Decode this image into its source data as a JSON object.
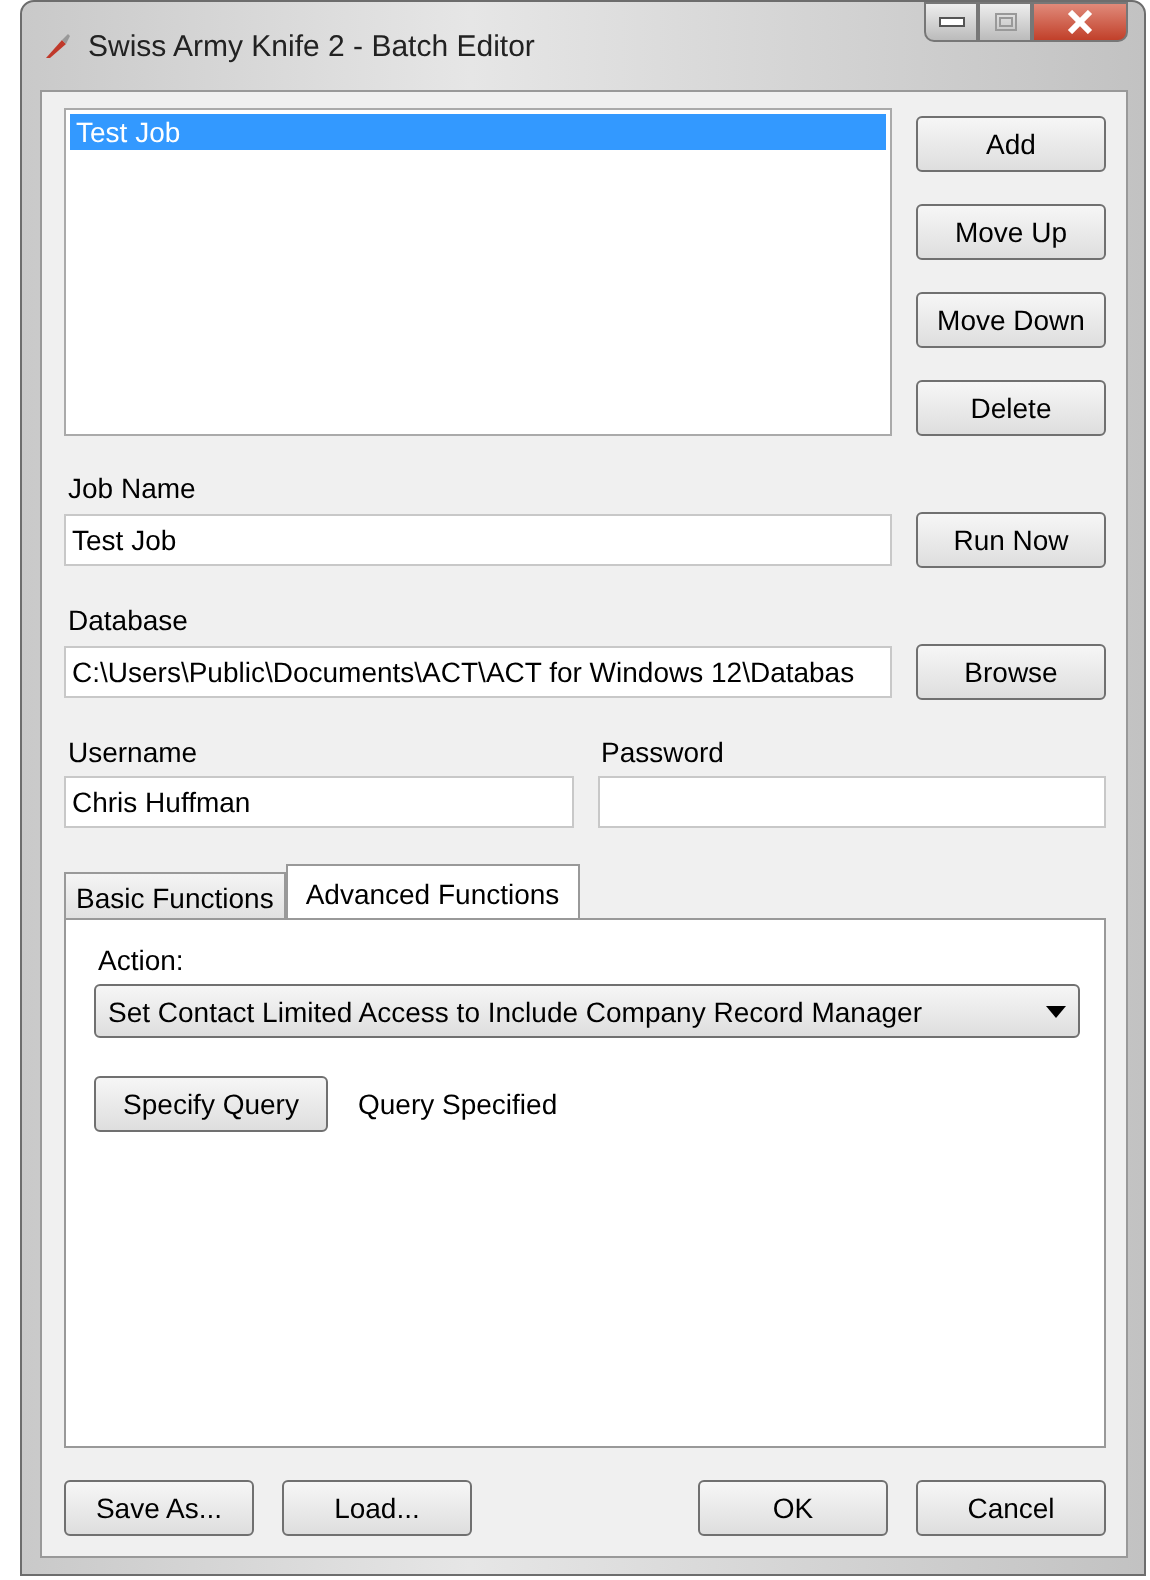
{
  "window": {
    "title": "Swiss Army Knife 2 - Batch Editor"
  },
  "jobs": [
    {
      "label": "Test Job",
      "selected": true
    }
  ],
  "job_buttons": [
    "Add",
    "Move Up",
    "Move Down",
    "Delete"
  ],
  "job_name": {
    "label": "Job Name",
    "value": "Test Job",
    "button": "Run Now"
  },
  "database": {
    "label": "Database",
    "value": "C:\\Users\\Public\\Documents\\ACT\\ACT for Windows 12\\Databas",
    "button": "Browse"
  },
  "username": {
    "label": "Username",
    "value": "Chris Huffman"
  },
  "password": {
    "label": "Password"
  },
  "tabs": [
    {
      "label": "Basic Functions",
      "selected": false
    },
    {
      "label": "Advanced Functions",
      "selected": true
    }
  ],
  "action": {
    "label": "Action:",
    "value": "Set Contact Limited Access to Include Company Record Manager"
  },
  "query": {
    "button": "Specify Query",
    "status": "Query Specified"
  },
  "footer_left": [
    "Save As...",
    "Load..."
  ],
  "footer_right": [
    "OK",
    "Cancel"
  ]
}
